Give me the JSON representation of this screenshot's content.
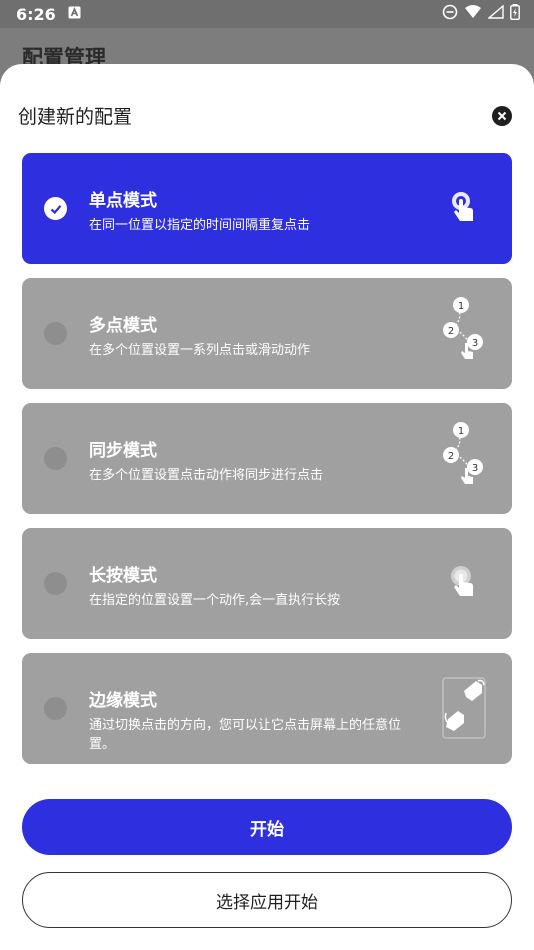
{
  "status_bar": {
    "time": "6:26",
    "notification_icon": "a-box-icon",
    "icons": [
      "dnd-icon",
      "wifi-icon",
      "signal-icon",
      "battery-charging-icon"
    ]
  },
  "app": {
    "title": "配置管理"
  },
  "sheet": {
    "title": "创建新的配置",
    "close_icon": "close-circle-icon"
  },
  "modes": [
    {
      "name": "单点模式",
      "desc": "在同一位置以指定的时间间隔重复点击",
      "selected": true,
      "icon": "single-tap-icon"
    },
    {
      "name": "多点模式",
      "desc": "在多个位置设置一系列点击或滑动动作",
      "selected": false,
      "icon": "multi-tap-icon"
    },
    {
      "name": "同步模式",
      "desc": "在多个位置设置点击动作将同步进行点击",
      "selected": false,
      "icon": "sync-tap-icon"
    },
    {
      "name": "长按模式",
      "desc": "在指定的位置设置一个动作,会一直执行长按",
      "selected": false,
      "icon": "long-press-icon"
    },
    {
      "name": "边缘模式",
      "desc": "通过切换点击的方向，您可以让它点击屏幕上的任意位置。",
      "selected": false,
      "icon": "edge-tap-icon"
    }
  ],
  "multi_icon_labels": [
    "1",
    "2",
    "3"
  ],
  "buttons": {
    "start": "开始",
    "select_app_start": "选择应用开始"
  },
  "colors": {
    "accent": "#2e2fde",
    "card_inactive": "#a0a0a0",
    "radio_inactive": "#8e8e8e"
  }
}
